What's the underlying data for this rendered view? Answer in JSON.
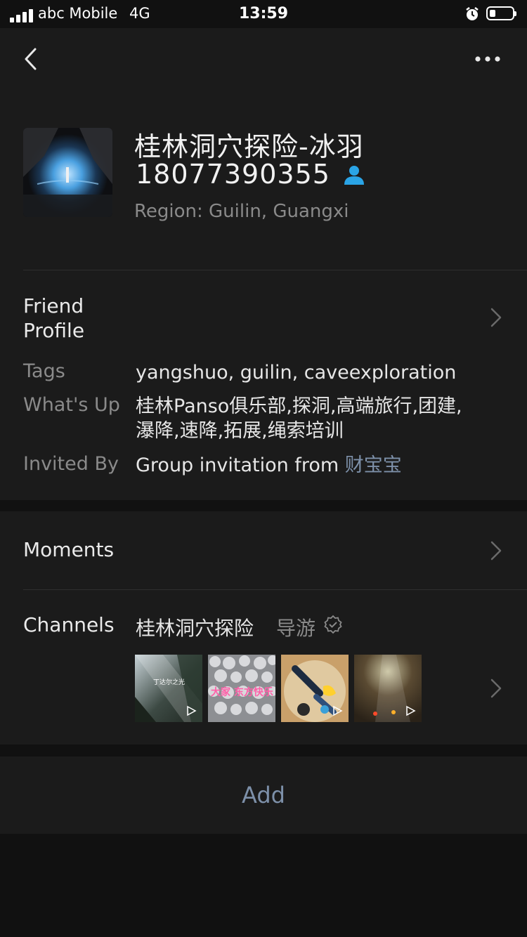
{
  "status_bar": {
    "carrier": "abc Mobile",
    "network": "4G",
    "time": "13:59"
  },
  "profile": {
    "name": "桂林洞穴探险-冰羽",
    "wechat_id": "18077390355",
    "region": "Region: Guilin, Guangxi"
  },
  "friend_profile": {
    "title_line1": "Friend",
    "title_line2": "Profile",
    "tags_label": "Tags",
    "tags_value": "yangshuo, guilin, caveexploration",
    "whatsup_label": "What's Up",
    "whatsup_line1": "桂林Panso俱乐部,探洞,高端旅行,团建,",
    "whatsup_line2": "瀑降,速降,拓展,绳索培训",
    "invited_label": "Invited By",
    "invited_prefix": "Group invitation from ",
    "invited_name": "财宝宝"
  },
  "moments": {
    "label": "Moments"
  },
  "channels": {
    "label": "Channels",
    "name": "桂林洞穴探险",
    "role": "导游",
    "thumb1_caption": "丁达尔之光",
    "thumb2_caption": "大家 东方快乐"
  },
  "actions": {
    "add_label": "Add"
  },
  "colors": {
    "background": "#111111",
    "card": "#1b1b1b",
    "link": "#7d90a9",
    "secondary_text": "#8a8a8a",
    "id_icon": "#2aa4e6"
  },
  "icons": [
    "back-icon",
    "more-icon",
    "person-icon",
    "chevron-right-icon",
    "verified-icon",
    "play-icon",
    "alarm-icon",
    "battery-icon",
    "signal-icon"
  ]
}
